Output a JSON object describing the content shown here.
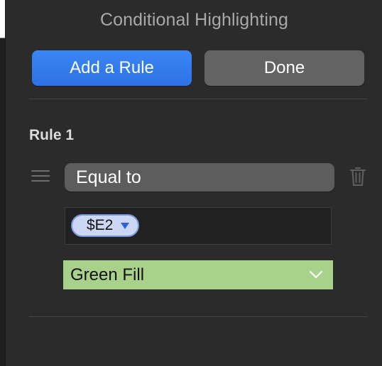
{
  "sheet_edge": {},
  "panel": {
    "title": "Conditional Highlighting",
    "add_rule_label": "Add a Rule",
    "done_label": "Done"
  },
  "rule": {
    "heading": "Rule 1",
    "condition": "Equal to",
    "value_token": "$E2",
    "style": "Green Fill"
  },
  "colors": {
    "accent": "#2f7af0",
    "fill_style": "#a8d18a",
    "token_bg": "#ccd8f3"
  },
  "icons": [
    "drag-handle-icon",
    "trash-icon",
    "dropdown-arrow-icon",
    "chevron-down-icon"
  ]
}
